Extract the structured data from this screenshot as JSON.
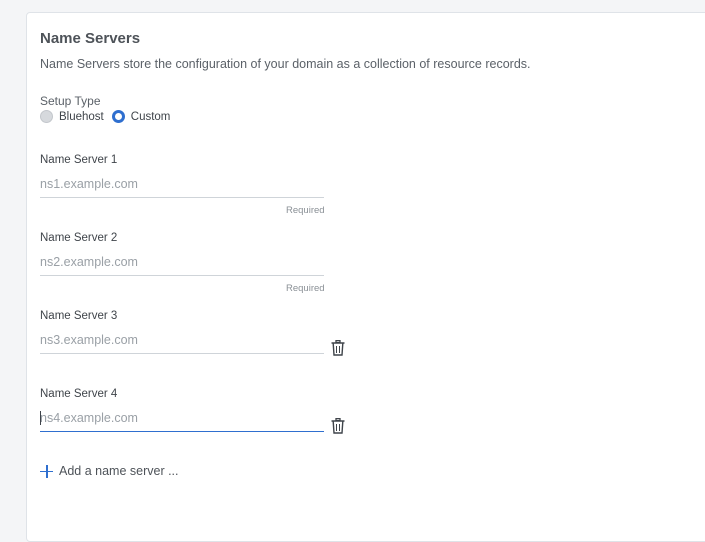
{
  "section": {
    "title": "Name Servers",
    "description": "Name Servers store the configuration of your domain as a collection of resource records."
  },
  "setup_type": {
    "label": "Setup Type",
    "options": [
      {
        "label": "Bluehost",
        "selected": false
      },
      {
        "label": "Custom",
        "selected": true
      }
    ]
  },
  "name_servers": [
    {
      "label": "Name Server 1",
      "value": "",
      "placeholder": "ns1.example.com",
      "hint": "Required",
      "deletable": false
    },
    {
      "label": "Name Server 2",
      "value": "",
      "placeholder": "ns2.example.com",
      "hint": "Required",
      "deletable": false
    },
    {
      "label": "Name Server 3",
      "value": "",
      "placeholder": "ns3.example.com",
      "hint": "",
      "deletable": true
    },
    {
      "label": "Name Server 4",
      "value": "",
      "placeholder": "ns4.example.com",
      "hint": "",
      "deletable": true,
      "focused": true
    }
  ],
  "add_button": {
    "label": "Add a name server ..."
  },
  "colors": {
    "accent": "#2f6fcf",
    "text": "#4a4f55",
    "muted": "#9aa0a6",
    "border": "#cfd4d9"
  },
  "icons": {
    "delete": "trash-icon",
    "add": "plus-icon"
  }
}
